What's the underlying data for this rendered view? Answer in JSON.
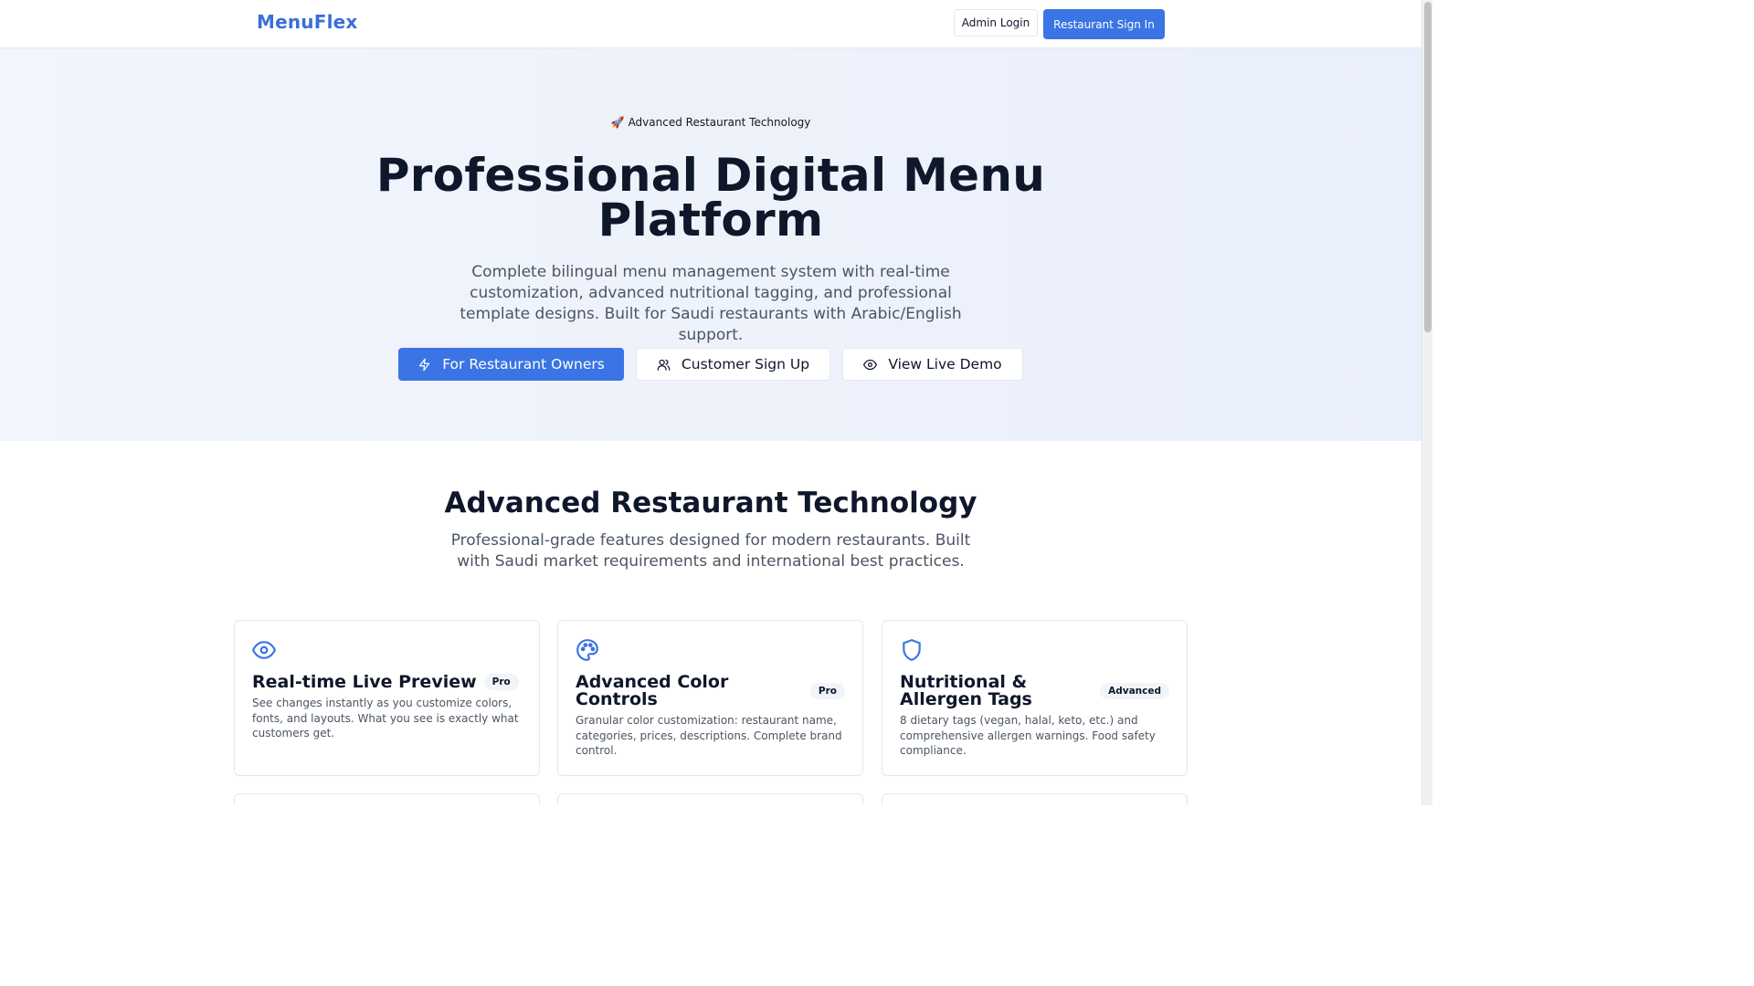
{
  "header": {
    "brand": "MenuFlex",
    "admin_login": "Admin Login",
    "restaurant_sign_in": "Restaurant Sign In"
  },
  "hero": {
    "pill_icon": "rocket-icon",
    "pill_text": "Advanced Restaurant Technology",
    "title_line1": "Professional Digital Menu",
    "title_line2": "Platform",
    "subtitle": "Complete bilingual menu management system with real-time customization, advanced nutritional tagging, and professional template designs. Built for Saudi restaurants with Arabic/English support.",
    "buttons": {
      "owners": "For Restaurant Owners",
      "signup": "Customer Sign Up",
      "demo": "View Live Demo"
    }
  },
  "features": {
    "title": "Advanced Restaurant Technology",
    "subtitle": "Professional-grade features designed for modern restaurants. Built with Saudi market requirements and international best practices.",
    "cards": [
      {
        "icon": "eye-icon",
        "title": "Real-time Live Preview",
        "badge": "Pro",
        "description": "See changes instantly as you customize colors, fonts, and layouts. What you see is exactly what customers get."
      },
      {
        "icon": "palette-icon",
        "title": "Advanced Color Controls",
        "badge": "Pro",
        "description": "Granular color customization: restaurant name, categories, prices, descriptions. Complete brand control."
      },
      {
        "icon": "shield-icon",
        "title": "Nutritional & Allergen Tags",
        "badge": "Advanced",
        "description": "8 dietary tags (vegan, halal, keto, etc.) and comprehensive allergen warnings. Food safety compliance."
      }
    ]
  },
  "colors": {
    "accent": "#3b74e4",
    "brand": "#3b6fd9",
    "text": "#0f172a",
    "muted": "#4b5563"
  }
}
